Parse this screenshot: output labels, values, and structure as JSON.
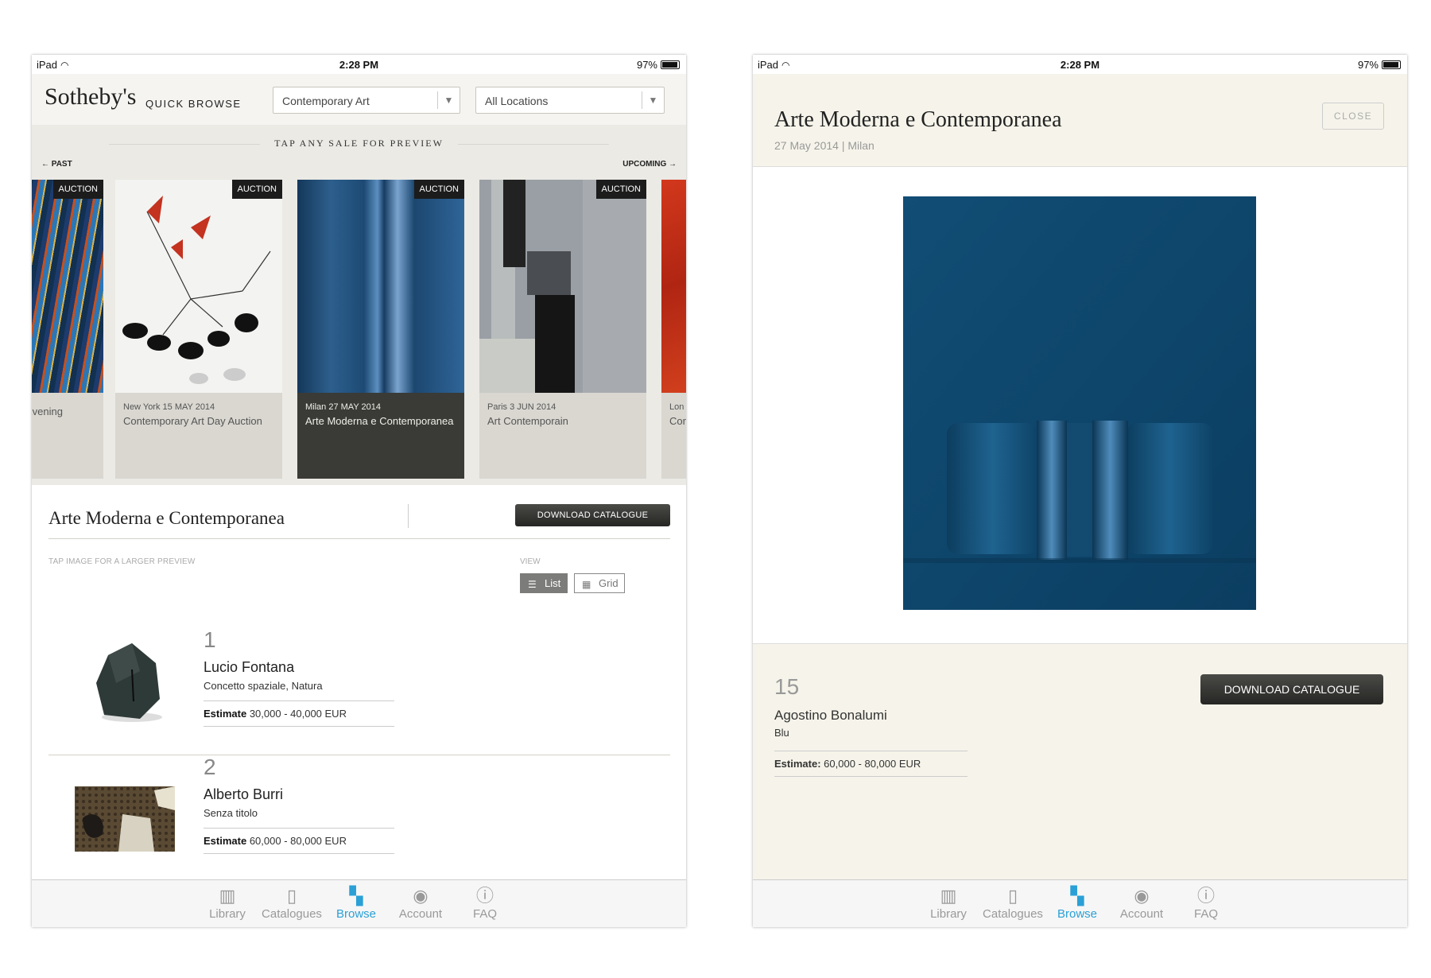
{
  "left": {
    "status": {
      "device": "iPad",
      "time": "2:28 PM",
      "battery": "97%"
    },
    "header": {
      "logo": "Sotheby's",
      "quick_browse": "QUICK BROWSE",
      "category_select": "Contemporary Art",
      "location_select": "All Locations"
    },
    "carousel": {
      "tap_hint": "TAP ANY SALE FOR PREVIEW",
      "past": "← PAST",
      "upcoming": "UPCOMING →",
      "cards": [
        {
          "badge": "AUCTION",
          "meta": "",
          "name": "Evening"
        },
        {
          "badge": "AUCTION",
          "meta": "New York 15 MAY 2014",
          "name": "Contemporary Art Day Auction"
        },
        {
          "badge": "AUCTION",
          "meta": "Milan 27 MAY 2014",
          "name": "Arte Moderna e Contemporanea"
        },
        {
          "badge": "AUCTION",
          "meta": "Paris 3 JUN 2014",
          "name": "Art Contemporain"
        },
        {
          "badge": "",
          "meta": "Lon",
          "name": "Cor Auc"
        }
      ]
    },
    "sale": {
      "title": "Arte Moderna e Contemporanea",
      "download": "DOWNLOAD CATALOGUE",
      "hint": "TAP IMAGE FOR A LARGER PREVIEW",
      "view_label": "VIEW",
      "list": "List",
      "grid": "Grid"
    },
    "lots": [
      {
        "number": "1",
        "artist": "Lucio Fontana",
        "title": "Concetto spaziale, Natura",
        "estimate_label": "Estimate",
        "estimate": "30,000 - 40,000 EUR"
      },
      {
        "number": "2",
        "artist": "Alberto Burri",
        "title": "Senza titolo",
        "estimate_label": "Estimate",
        "estimate": "60,000 - 80,000 EUR"
      }
    ]
  },
  "right": {
    "status": {
      "device": "iPad",
      "time": "2:28 PM",
      "battery": "97%"
    },
    "title": "Arte Moderna e Contemporanea",
    "subtitle": "27 May 2014 | Milan",
    "close": "CLOSE",
    "lot": {
      "number": "15",
      "artist": "Agostino Bonalumi",
      "title": "Blu",
      "estimate_label": "Estimate:",
      "estimate": "60,000 - 80,000 EUR"
    },
    "download": "DOWNLOAD CATALOGUE"
  },
  "tabs": [
    {
      "label": "Library",
      "icon": "library-icon"
    },
    {
      "label": "Catalogues",
      "icon": "catalogues-icon"
    },
    {
      "label": "Browse",
      "icon": "browse-map-icon"
    },
    {
      "label": "Account",
      "icon": "account-icon"
    },
    {
      "label": "FAQ",
      "icon": "faq-icon"
    }
  ],
  "colors": {
    "accent": "#2aa0d6",
    "cream": "#f6f4ea",
    "dark_button": "#2e2e2c",
    "painting_blue": "#0f4d72"
  }
}
